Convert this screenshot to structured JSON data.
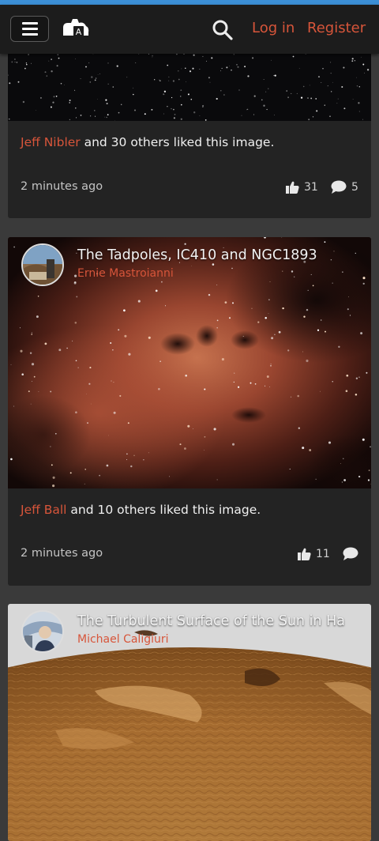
{
  "header": {
    "login_label": "Log in",
    "register_label": "Register",
    "accent_color": "#d7553a",
    "icons": [
      "menu-icon",
      "logo-icon",
      "search-icon"
    ]
  },
  "feed": [
    {
      "liker": "Jeff Nibler",
      "liked_text": " and 30 others liked this image.",
      "time": "2 minutes ago",
      "likes": "31",
      "comments": "5"
    },
    {
      "title": "The Tadpoles, IC410 and NGC1893",
      "author": "Ernie Mastroianni",
      "liker": "Jeff Ball",
      "liked_text": " and 10 others liked this image.",
      "time": "2 minutes ago",
      "likes": "11",
      "comments": ""
    },
    {
      "title": "The Turbulent Surface of the Sun in Ha",
      "author": "Michael Caligiuri"
    }
  ]
}
